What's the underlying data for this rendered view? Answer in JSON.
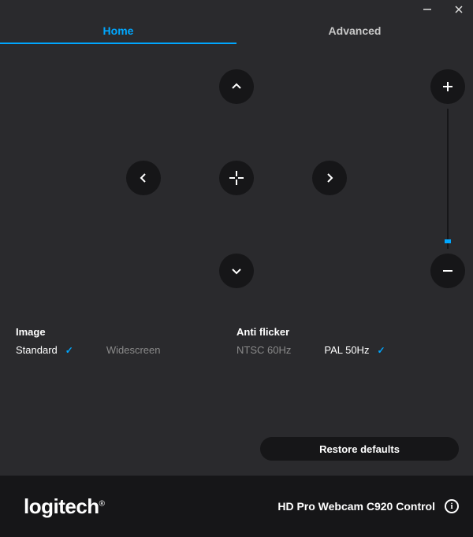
{
  "tabs": {
    "home": "Home",
    "advanced": "Advanced",
    "active": "home"
  },
  "image": {
    "header": "Image",
    "options": {
      "standard": "Standard",
      "widescreen": "Widescreen"
    },
    "selected": "standard"
  },
  "antiflicker": {
    "header": "Anti flicker",
    "options": {
      "ntsc": "NTSC 60Hz",
      "pal": "PAL 50Hz"
    },
    "selected": "pal"
  },
  "restore_label": "Restore defaults",
  "footer": {
    "brand": "logitech",
    "product": "HD Pro Webcam C920 Control"
  }
}
